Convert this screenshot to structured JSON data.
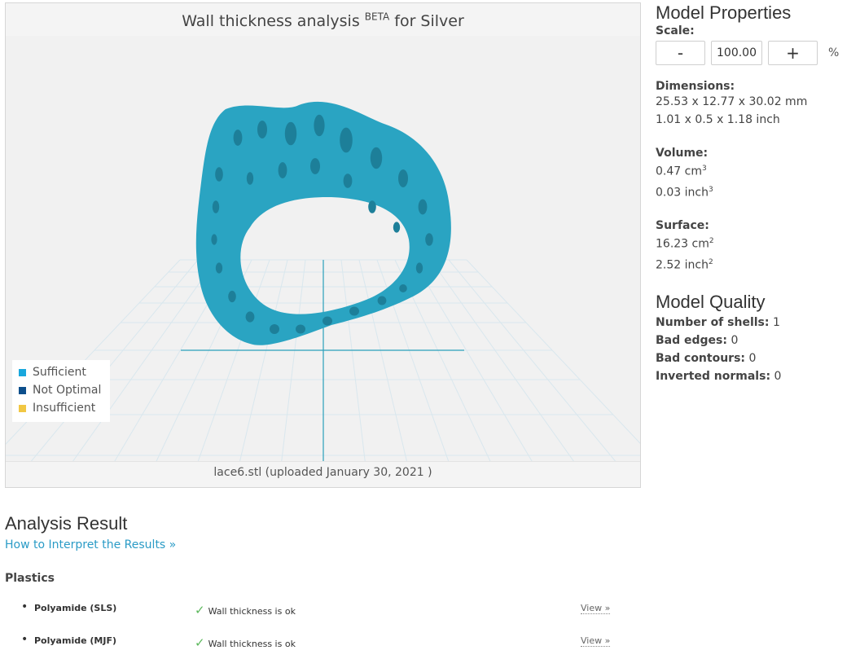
{
  "viewer": {
    "title_main": "Wall thickness analysis",
    "title_sup": "BETA",
    "title_tail": "for Silver",
    "footer": "lace6.stl (uploaded January 30, 2021 )",
    "model_color": "#2aa4c2",
    "legend": [
      {
        "label": "Sufficient",
        "color": "#19a7dd"
      },
      {
        "label": "Not Optimal",
        "color": "#0d4f8c"
      },
      {
        "label": "Insufficient",
        "color": "#f1c743"
      }
    ]
  },
  "properties": {
    "heading": "Model Properties",
    "scale_label": "Scale:",
    "scale_minus": "-",
    "scale_value": "100.00",
    "scale_plus": "+",
    "scale_unit": "%",
    "dimensions_label": "Dimensions:",
    "dimensions_mm": "25.53 x 12.77 x 30.02 mm",
    "dimensions_inch": "1.01 x 0.5 x 1.18 inch",
    "volume_label": "Volume:",
    "volume_cm": "0.47 cm",
    "volume_inch": "0.03 inch",
    "volume_exp": "3",
    "surface_label": "Surface:",
    "surface_cm": "16.23 cm",
    "surface_inch": "2.52 inch",
    "surface_exp": "2"
  },
  "quality": {
    "heading": "Model Quality",
    "items": [
      {
        "label": "Number of shells:",
        "value": "1"
      },
      {
        "label": "Bad edges:",
        "value": "0"
      },
      {
        "label": "Bad contours:",
        "value": "0"
      },
      {
        "label": "Inverted normals:",
        "value": "0"
      }
    ]
  },
  "analysis": {
    "heading": "Analysis Result",
    "link": "How to Interpret the Results »",
    "section": "Plastics",
    "rows": [
      {
        "name": "Polyamide (SLS)",
        "status": "Wall thickness is ok",
        "view": "View »"
      },
      {
        "name": "Polyamide (MJF)",
        "status": "Wall thickness is ok",
        "view": "View »"
      }
    ]
  }
}
